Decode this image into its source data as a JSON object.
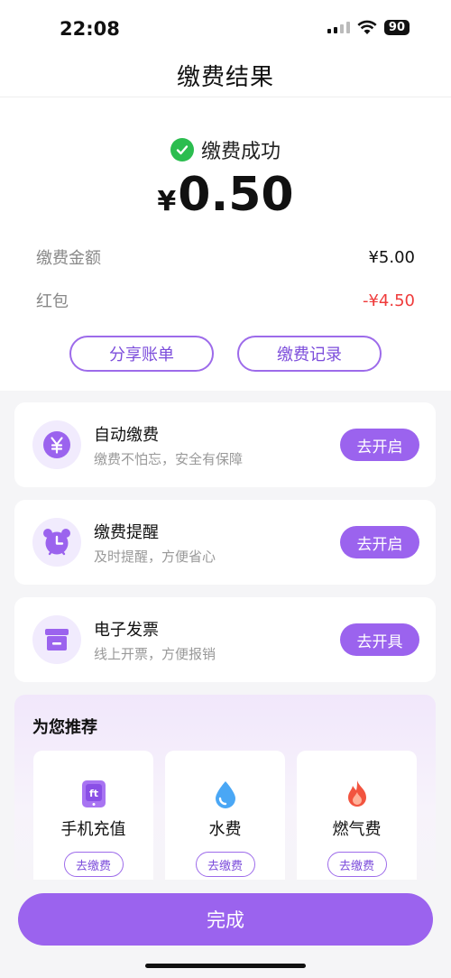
{
  "status_bar": {
    "time": "22:08",
    "battery": "90"
  },
  "nav": {
    "title": "缴费结果"
  },
  "result": {
    "status_text": "缴费成功",
    "currency": "¥",
    "amount": "0.50",
    "details": [
      {
        "label": "缴费金额",
        "value": "¥5.00"
      },
      {
        "label": "红包",
        "value": "-¥4.50"
      }
    ],
    "share_label": "分享账单",
    "records_label": "缴费记录"
  },
  "features": [
    {
      "title": "自动缴费",
      "desc": "缴费不怕忘，安全有保障",
      "button": "去开启",
      "icon": "yuan-coin-icon"
    },
    {
      "title": "缴费提醒",
      "desc": "及时提醒，方便省心",
      "button": "去开启",
      "icon": "alarm-clock-icon"
    },
    {
      "title": "电子发票",
      "desc": "线上开票，方便报销",
      "button": "去开具",
      "icon": "invoice-box-icon"
    }
  ],
  "recommend": {
    "title": "为您推荐",
    "items": [
      {
        "label": "手机充值",
        "button": "去缴费",
        "icon": "phone-recharge-icon"
      },
      {
        "label": "水费",
        "button": "去缴费",
        "icon": "water-drop-icon"
      },
      {
        "label": "燃气费",
        "button": "去缴费",
        "icon": "flame-icon"
      }
    ]
  },
  "done_label": "完成",
  "colors": {
    "accent": "#9b63ee",
    "success": "#2bbd4f",
    "discount": "#ef3b3b"
  }
}
